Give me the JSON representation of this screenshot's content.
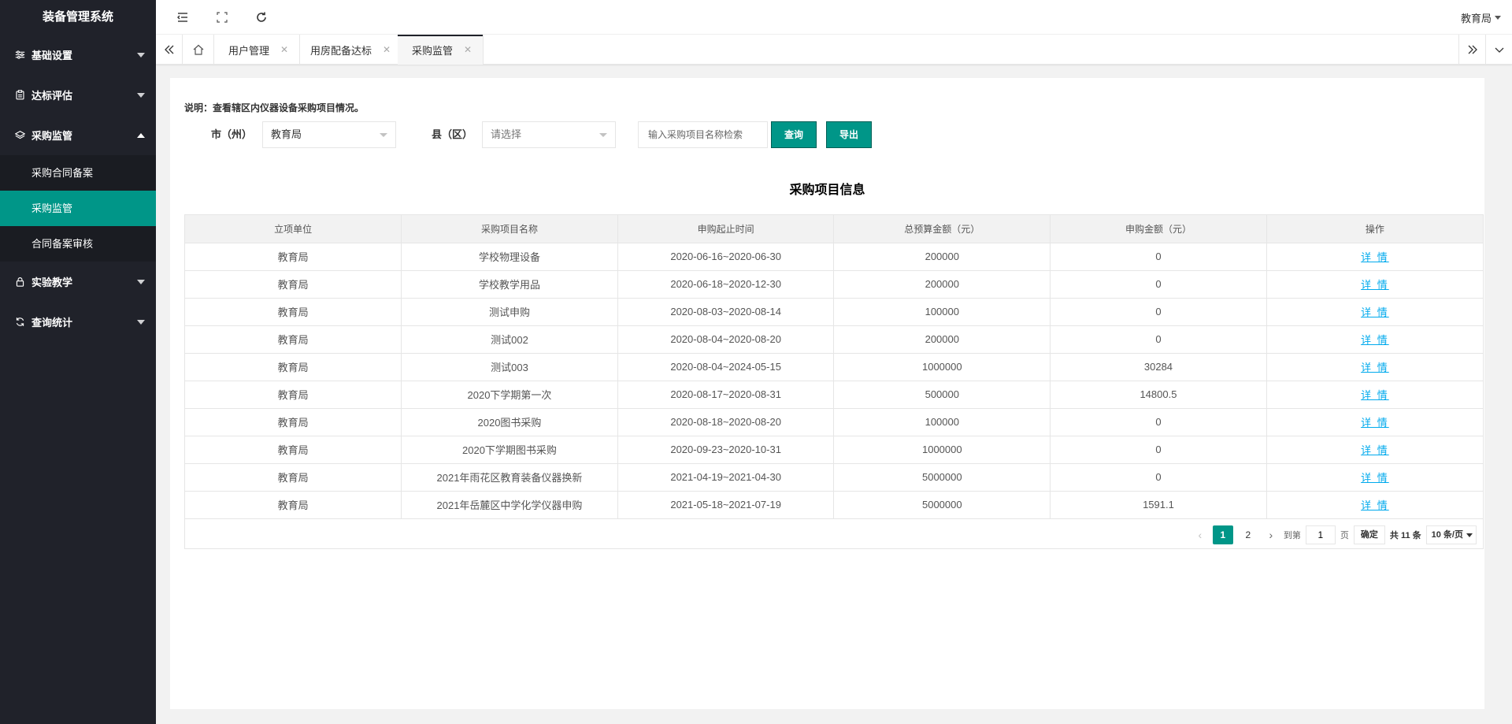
{
  "app": {
    "title": "装备管理系统"
  },
  "sidebar": {
    "items": [
      {
        "label": "基础设置",
        "icon": "sliders-icon",
        "expanded": false
      },
      {
        "label": "达标评估",
        "icon": "clipboard-icon",
        "expanded": false
      },
      {
        "label": "采购监管",
        "icon": "layers-icon",
        "expanded": true,
        "children": [
          {
            "label": "采购合同备案",
            "active": false
          },
          {
            "label": "采购监管",
            "active": true
          },
          {
            "label": "合同备案审核",
            "active": false
          }
        ]
      },
      {
        "label": "实验教学",
        "icon": "lock-icon",
        "expanded": false
      },
      {
        "label": "查询统计",
        "icon": "refresh-icon",
        "expanded": false
      }
    ]
  },
  "header": {
    "user": "教育局"
  },
  "tabs": [
    {
      "label": "用户管理",
      "active": false
    },
    {
      "label": "用房配备达标",
      "active": false
    },
    {
      "label": "采购监管",
      "active": true
    }
  ],
  "filters": {
    "description": "说明：查看辖区内仪器设备采购项目情况。",
    "city_label": "市（州）",
    "city_value": "教育局",
    "county_label": "县（区）",
    "county_placeholder": "请选择",
    "search_placeholder": "输入采购项目名称检索",
    "query_button": "查询",
    "export_button": "导出"
  },
  "section_title": "采购项目信息",
  "table": {
    "headers": [
      "立项单位",
      "采购项目名称",
      "申购起止时间",
      "总预算金额（元）",
      "申购金额（元）",
      "操作"
    ],
    "rows": [
      [
        "教育局",
        "学校物理设备",
        "2020-06-16~2020-06-30",
        "200000",
        "0",
        "详 情"
      ],
      [
        "教育局",
        "学校教学用品",
        "2020-06-18~2020-12-30",
        "200000",
        "0",
        "详 情"
      ],
      [
        "教育局",
        "测试申购",
        "2020-08-03~2020-08-14",
        "100000",
        "0",
        "详 情"
      ],
      [
        "教育局",
        "测试002",
        "2020-08-04~2020-08-20",
        "200000",
        "0",
        "详 情"
      ],
      [
        "教育局",
        "测试003",
        "2020-08-04~2024-05-15",
        "1000000",
        "30284",
        "详 情"
      ],
      [
        "教育局",
        "2020下学期第一次",
        "2020-08-17~2020-08-31",
        "500000",
        "14800.5",
        "详 情"
      ],
      [
        "教育局",
        "2020图书采购",
        "2020-08-18~2020-08-20",
        "100000",
        "0",
        "详 情"
      ],
      [
        "教育局",
        "2020下学期图书采购",
        "2020-09-23~2020-10-31",
        "1000000",
        "0",
        "详 情"
      ],
      [
        "教育局",
        "2021年雨花区教育装备仪器换新",
        "2021-04-19~2021-04-30",
        "5000000",
        "0",
        "详 情"
      ],
      [
        "教育局",
        "2021年岳麓区中学化学仪器申购",
        "2021-05-18~2021-07-19",
        "5000000",
        "1591.1",
        "详 情"
      ]
    ]
  },
  "pagination": {
    "pages": [
      "1",
      "2"
    ],
    "current": "1",
    "goto_prefix": "到第",
    "goto_value": "1",
    "goto_suffix": "页",
    "confirm": "确定",
    "total": "共 11 条",
    "page_size": "10 条/页"
  },
  "colors": {
    "sidebar_bg": "#20222a",
    "accent": "#009688",
    "link": "#01aaed"
  }
}
